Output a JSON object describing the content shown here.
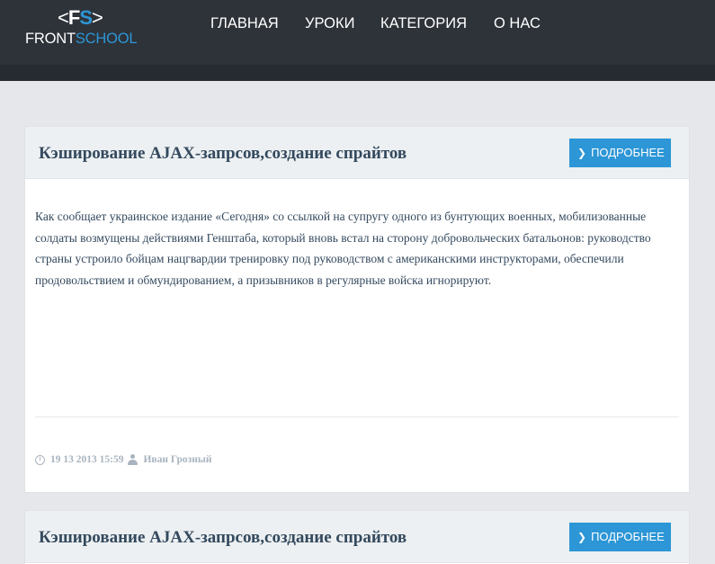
{
  "brand": {
    "logo_left": "<",
    "logo_f": "F",
    "logo_s": "S",
    "logo_right": ">",
    "name_front": "FRONT",
    "name_school": "SCHOOL"
  },
  "nav": {
    "items": [
      "ГЛАВНАЯ",
      "УРОКИ",
      "КАТЕГОРИЯ",
      "О НАС"
    ]
  },
  "posts": [
    {
      "title": "Кэширование AJAX-запрсов,создание спрайтов",
      "button": "ПОДРОБНЕЕ",
      "body": "Как сообщает украинское издание «Сегодня» со ссылкой на супругу одного из бунтующих военных, мобилизованные солдаты возмущены действиями Генштаба, который вновь встал на сторону добровольческих батальонов: руководство страны устроило бойцам нацгвардии тренировку под руководством с американскими инструкторами, обеспечили продовольствием и обмундированием, а призывников в регулярные войска игнорируют.",
      "date": "19 13 2013 15:59",
      "author": "Иван Грозный"
    },
    {
      "title": "Кэширование AJAX-запрсов,создание спрайтов",
      "button": "ПОДРОБНЕЕ"
    }
  ],
  "colors": {
    "header_bg": "#2e333a",
    "accent": "#2d96d6",
    "page_bg": "#e5e7ea",
    "title_text": "#34495e"
  }
}
